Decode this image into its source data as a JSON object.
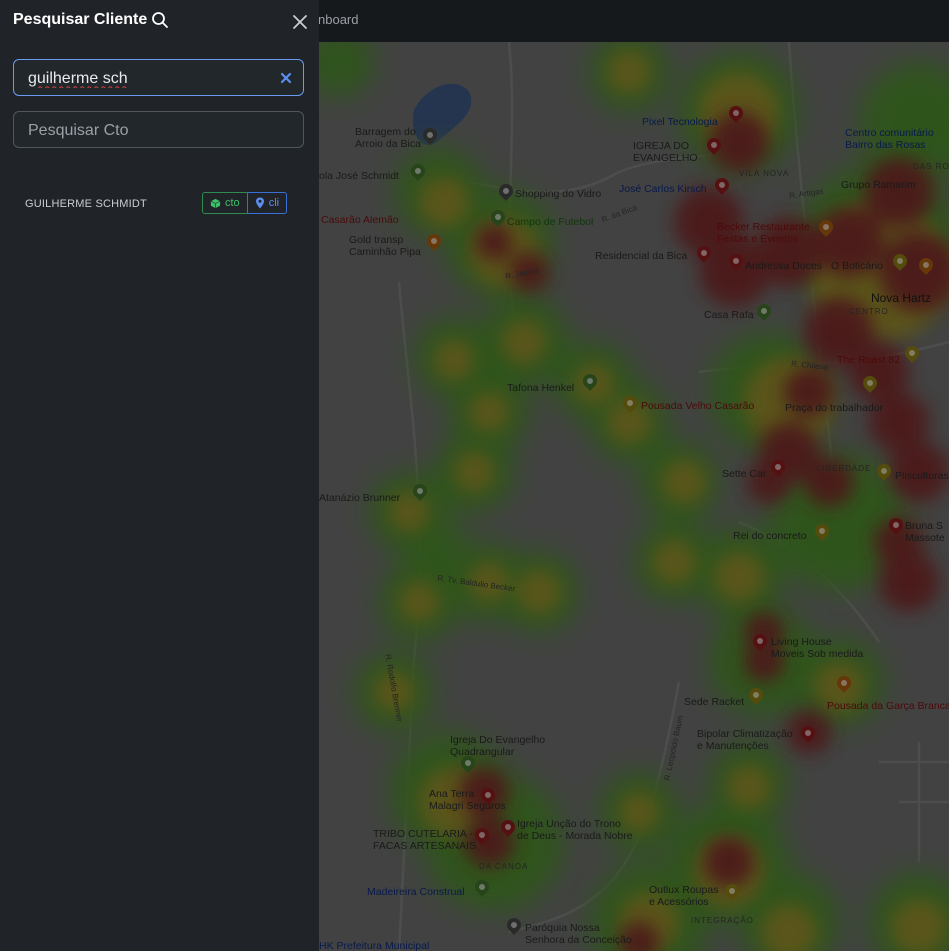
{
  "topbar": {
    "title_fragment": "nboard"
  },
  "sidebar": {
    "title": "Pesquisar Cliente",
    "client_search": {
      "value": "guilherme sch",
      "placeholder": "Pesquisar Cliente"
    },
    "cto_search": {
      "value": "",
      "placeholder": "Pesquisar Cto"
    },
    "results": [
      {
        "name": "GUILHERME SCHMIDT",
        "cto_label": "cto",
        "cli_label": "cli"
      }
    ]
  },
  "map": {
    "labels": {
      "barragem": "Barragem do\nArroio da Bica",
      "escola": "ola José Schmidt",
      "casarao": "Casarão Alemão",
      "gold": "Gold transp\nCaminhão Pipa",
      "shopping": "Shopping do Vidro",
      "campo": "Campo de Futebol",
      "residencial": "Residencial da Bica",
      "pixel": "Pixel Tecnologia",
      "igreja_evangelho": "IGREJA DO\nEVANGELHO",
      "jose_kirsch": "José Carlos Kirsch",
      "becker": "Becker Restaurante\nFestas e Eventos",
      "andressa": "Andressa Doces",
      "boticario": "O Boticário",
      "casa_rafa": "Casa Rafa",
      "centro_comunitario": "Centro comunitário\nBairro das Rosas",
      "grupo_ramarim": "Grupo Ramarim",
      "nova_hartz": "Nova Hartz",
      "the_roast": "The Roast 82",
      "praca": "Praça do trabalhador",
      "tafona": "Tafona Henkel",
      "pousada_velho": "Pousada Velho Casarão",
      "sette": "Sette Car",
      "atanazio": "Atanázio Brunner",
      "rei_concreto": "Rei do concreto",
      "plisculturas": "Plisculturas",
      "bruna": "Bruna S\nMassote",
      "living": "Living House\nMoveis Sob medida",
      "sede_racket": "Sede Racket",
      "pousada_garca": "Pousada da Garça Branca",
      "bipolar": "Bipolar Climatização\ne Manutenções",
      "igreja_quadrangular": "Igreja Do Evangelho\nQuadrangular",
      "ana_terra": "Ana Terra\nMalagri Seguros",
      "igreja_uncao": "Igreja Unção do Trono\nde Deus - Morada Nobre",
      "tribo": "TRIBO CUTELARIA -\nFACAS ARTESANAIS",
      "madeireira": "Madeireira Construal",
      "outlux": "Outlux Roupas\ne Acessórios",
      "paroquia": "Paróquia Nossa\nSenhora da Conceição",
      "prefeitura": "HK Prefeitura Municipal",
      "vila_nova": "VILA NOVA",
      "centro": "CENTRO",
      "liberdade": "LIBERDADE",
      "da_canoa": "DA CANOA",
      "integracao": "INTEGRAÇÃO",
      "das_rosas": "DAS ROS",
      "r_leopoldo": "R. Leopoldo Baum",
      "r_rodolfo": "R. Rodolfo Brenner",
      "r_baldulio": "R. Tv. Baldulio Becker",
      "r_chileva": "R. Chileva",
      "r_artigas": "R. Artigas",
      "r_jatoba": "R. Jatobá",
      "r_bica": "R. da Bica"
    }
  },
  "colors": {
    "sidebar_bg": "#202428",
    "topbar_bg": "#16191c",
    "input_focus_border": "#6a9bf0",
    "cto_badge": "#3fbf6a",
    "cli_badge": "#5b8ef0"
  },
  "icons": {
    "title_icon": "search-icon",
    "close": "close-icon",
    "clear": "clear-x-icon",
    "cto_badge_icon": "cube-icon",
    "cli_badge_icon": "map-pin-icon"
  }
}
